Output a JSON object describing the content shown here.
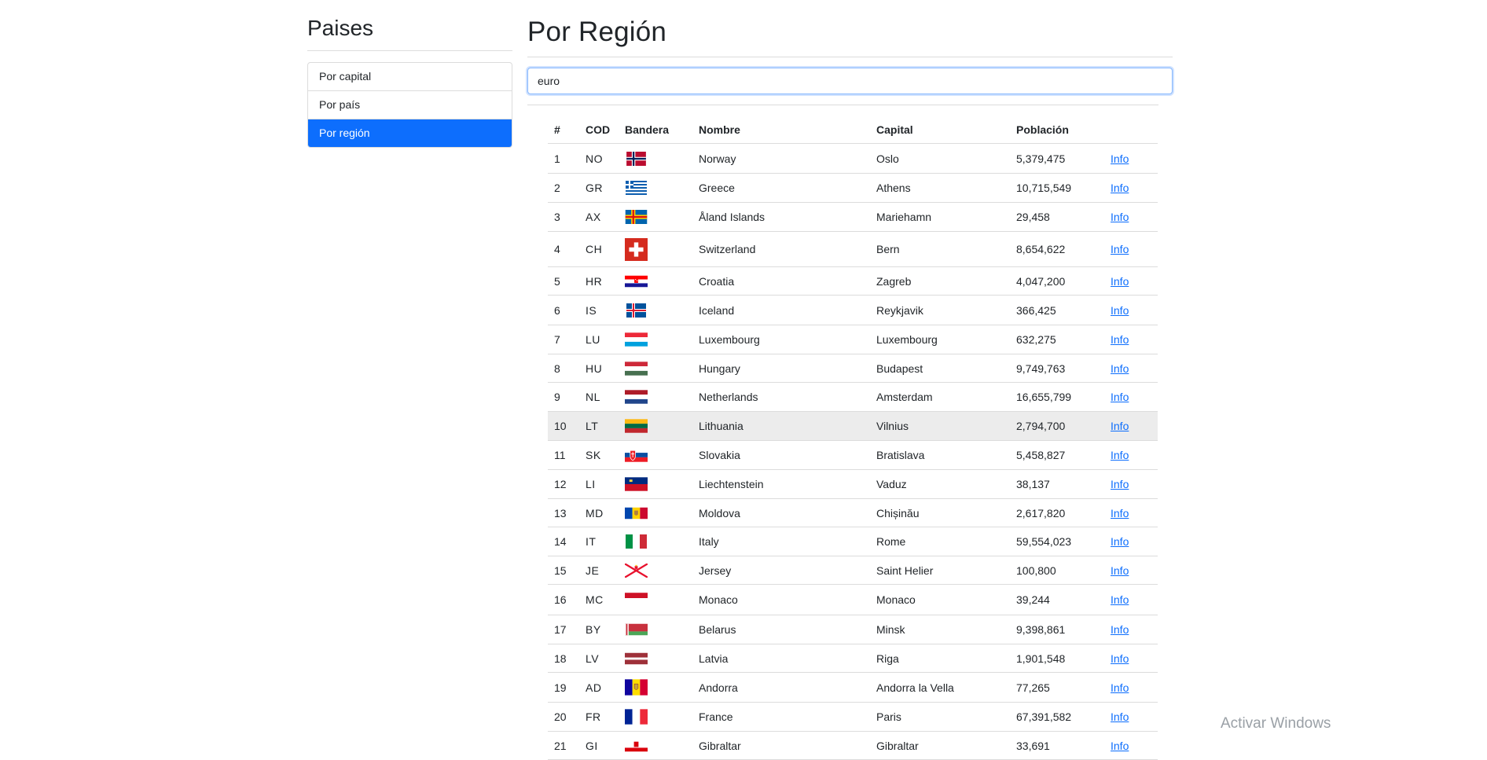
{
  "sidebar": {
    "title": "Paises",
    "items": [
      {
        "label": "Por capital",
        "active": false
      },
      {
        "label": "Por país",
        "active": false
      },
      {
        "label": "Por región",
        "active": true
      }
    ]
  },
  "main": {
    "title": "Por Región",
    "search_value": "euro"
  },
  "table": {
    "headers": [
      "#",
      "COD",
      "Bandera",
      "Nombre",
      "Capital",
      "Población",
      ""
    ],
    "info_label": "Info",
    "rows": [
      {
        "n": "1",
        "code": "NO",
        "flag": "flag-norway",
        "name": "Norway",
        "capital": "Oslo",
        "pop": "5,379,475"
      },
      {
        "n": "2",
        "code": "GR",
        "flag": "flag-greece",
        "name": "Greece",
        "capital": "Athens",
        "pop": "10,715,549"
      },
      {
        "n": "3",
        "code": "AX",
        "flag": "flag-aland",
        "name": "Åland Islands",
        "capital": "Mariehamn",
        "pop": "29,458"
      },
      {
        "n": "4",
        "code": "CH",
        "flag": "flag-switzerland",
        "name": "Switzerland",
        "capital": "Bern",
        "pop": "8,654,622"
      },
      {
        "n": "5",
        "code": "HR",
        "flag": "flag-croatia",
        "name": "Croatia",
        "capital": "Zagreb",
        "pop": "4,047,200"
      },
      {
        "n": "6",
        "code": "IS",
        "flag": "flag-iceland",
        "name": "Iceland",
        "capital": "Reykjavik",
        "pop": "366,425"
      },
      {
        "n": "7",
        "code": "LU",
        "flag": "flag-luxembourg",
        "name": "Luxembourg",
        "capital": "Luxembourg",
        "pop": "632,275"
      },
      {
        "n": "8",
        "code": "HU",
        "flag": "flag-hungary",
        "name": "Hungary",
        "capital": "Budapest",
        "pop": "9,749,763"
      },
      {
        "n": "9",
        "code": "NL",
        "flag": "flag-netherlands",
        "name": "Netherlands",
        "capital": "Amsterdam",
        "pop": "16,655,799"
      },
      {
        "n": "10",
        "code": "LT",
        "flag": "flag-lithuania",
        "name": "Lithuania",
        "capital": "Vilnius",
        "pop": "2,794,700"
      },
      {
        "n": "11",
        "code": "SK",
        "flag": "flag-slovakia",
        "name": "Slovakia",
        "capital": "Bratislava",
        "pop": "5,458,827"
      },
      {
        "n": "12",
        "code": "LI",
        "flag": "flag-liechtenstein",
        "name": "Liechtenstein",
        "capital": "Vaduz",
        "pop": "38,137"
      },
      {
        "n": "13",
        "code": "MD",
        "flag": "flag-moldova",
        "name": "Moldova",
        "capital": "Chișinău",
        "pop": "2,617,820"
      },
      {
        "n": "14",
        "code": "IT",
        "flag": "flag-italy",
        "name": "Italy",
        "capital": "Rome",
        "pop": "59,554,023"
      },
      {
        "n": "15",
        "code": "JE",
        "flag": "flag-jersey",
        "name": "Jersey",
        "capital": "Saint Helier",
        "pop": "100,800"
      },
      {
        "n": "16",
        "code": "MC",
        "flag": "flag-monaco",
        "name": "Monaco",
        "capital": "Monaco",
        "pop": "39,244"
      },
      {
        "n": "17",
        "code": "BY",
        "flag": "flag-belarus",
        "name": "Belarus",
        "capital": "Minsk",
        "pop": "9,398,861"
      },
      {
        "n": "18",
        "code": "LV",
        "flag": "flag-latvia",
        "name": "Latvia",
        "capital": "Riga",
        "pop": "1,901,548"
      },
      {
        "n": "19",
        "code": "AD",
        "flag": "flag-andorra",
        "name": "Andorra",
        "capital": "Andorra la Vella",
        "pop": "77,265"
      },
      {
        "n": "20",
        "code": "FR",
        "flag": "flag-france",
        "name": "France",
        "capital": "Paris",
        "pop": "67,391,582"
      },
      {
        "n": "21",
        "code": "GI",
        "flag": "flag-gibraltar",
        "name": "Gibraltar",
        "capital": "Gibraltar",
        "pop": "33,691"
      }
    ]
  },
  "watermark": "Activar Windows",
  "colors": {
    "accent": "#0d6efd",
    "highlight_row": "#ececec",
    "border": "#dcdcdc"
  }
}
